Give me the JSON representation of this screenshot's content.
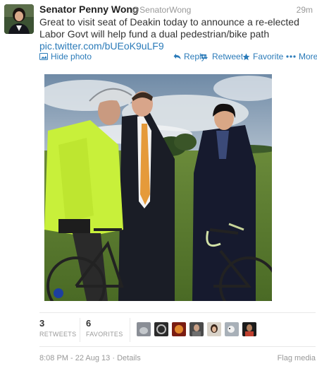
{
  "tweet": {
    "author_name": "Senator Penny Wong",
    "author_handle": "@SenatorWong",
    "time_ago": "29m",
    "text": "Great to visit seat of Deakin today to announce a re-elected Labor Govt will help fund a dual pedestrian/bike path",
    "link": "pic.twitter.com/bUEoK9uLF9"
  },
  "actions": {
    "hide_photo": "Hide photo",
    "reply": "Reply",
    "retweet": "Retweet",
    "favorite": "Favorite",
    "more": "More"
  },
  "stats": {
    "retweets_count": "3",
    "retweets_label": "RETWEETS",
    "favorites_count": "6",
    "favorites_label": "FAVORITES"
  },
  "footer": {
    "timestamp": "8:08 PM - 22 Aug 13",
    "separator": "·",
    "details": "Details",
    "flag": "Flag media"
  },
  "colors": {
    "link": "#2b7bb9",
    "muted": "#999999",
    "text": "#333333"
  }
}
